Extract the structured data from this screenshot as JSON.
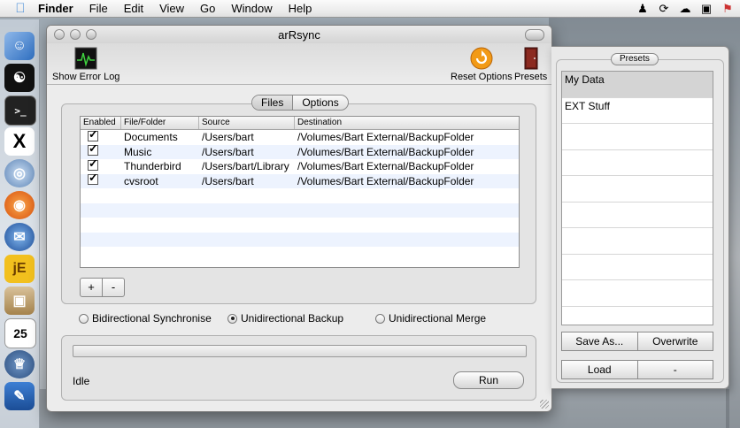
{
  "menubar": {
    "app": "Finder",
    "items": [
      "File",
      "Edit",
      "View",
      "Go",
      "Window",
      "Help"
    ]
  },
  "window": {
    "title": "arRsync",
    "toolbar": {
      "error_log_label": "Show Error Log",
      "reset_label": "Reset Options",
      "presets_label": "Presets"
    },
    "tabs": [
      "Files",
      "Options"
    ],
    "table": {
      "columns": [
        "Enabled",
        "File/Folder",
        "Source",
        "Destination"
      ],
      "rows": [
        {
          "enabled": true,
          "file": "Documents",
          "source": "/Users/bart",
          "destination": "/Volumes/Bart External/BackupFolder"
        },
        {
          "enabled": true,
          "file": "Music",
          "source": "/Users/bart",
          "destination": "/Volumes/Bart External/BackupFolder"
        },
        {
          "enabled": true,
          "file": "Thunderbird",
          "source": "/Users/bart/Library",
          "destination": "/Volumes/Bart External/BackupFolder"
        },
        {
          "enabled": true,
          "file": "cvsroot",
          "source": "/Users/bart",
          "destination": "/Volumes/Bart External/BackupFolder"
        }
      ]
    },
    "add_label": "+",
    "remove_label": "-",
    "modes": [
      {
        "label": "Bidirectional Synchronise",
        "selected": false
      },
      {
        "label": "Unidirectional Backup",
        "selected": true
      },
      {
        "label": "Unidirectional Merge",
        "selected": false
      }
    ],
    "progress": 0,
    "status": "Idle",
    "run_label": "Run"
  },
  "drawer": {
    "title": "Presets",
    "items": [
      "My Data",
      "EXT Stuff",
      "",
      "",
      "",
      "",
      "",
      "",
      "",
      ""
    ],
    "selected_index": 0,
    "save_as_label": "Save As...",
    "overwrite_label": "Overwrite",
    "load_label": "Load",
    "delete_label": "-"
  },
  "dock": {
    "icons": [
      "finder-icon",
      "terminal-icon",
      "x11-icon",
      "network-icon",
      "firefox-icon",
      "thunderbird-icon",
      "jedit-icon",
      "installer-icon",
      "calendar-icon",
      "postgres-icon",
      "editor-icon"
    ],
    "calendar_day": "25"
  }
}
